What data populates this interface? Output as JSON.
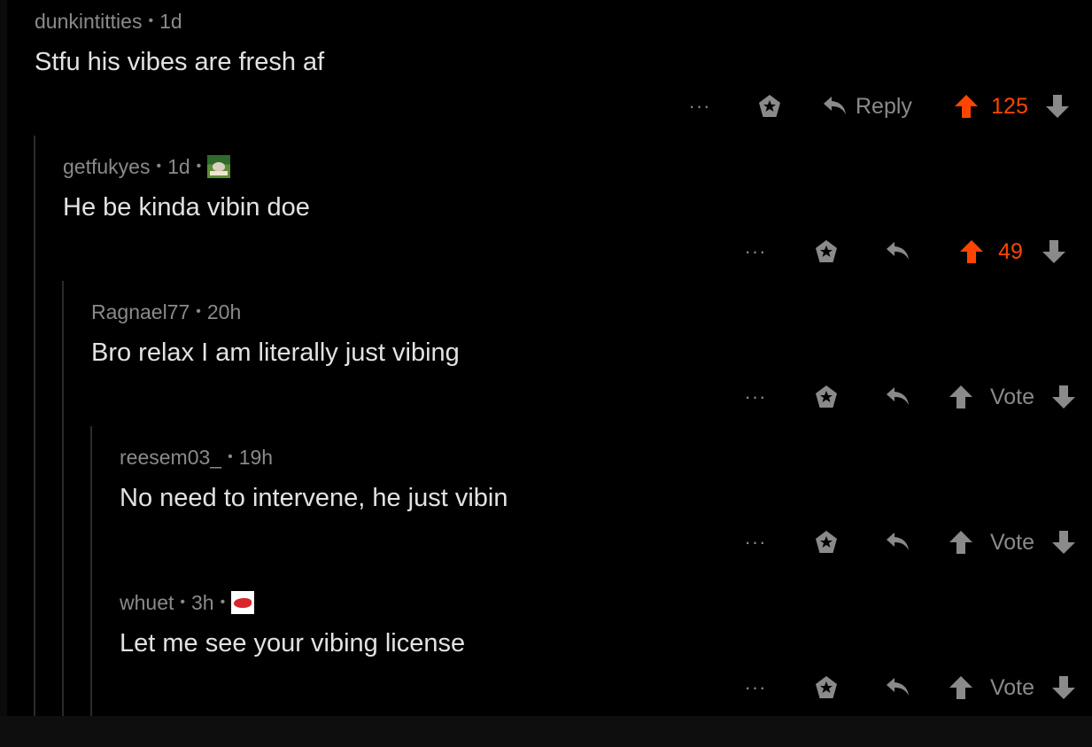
{
  "colors": {
    "background": "#000000",
    "upvoted": "#ff4500",
    "muted": "#8a8a8a",
    "text": "#e2e2e2",
    "thread_line": "#2b2b2b"
  },
  "actions": {
    "more_label": "···",
    "reply_label": "Reply",
    "vote_label": "Vote"
  },
  "comments": [
    {
      "author": "dunkintitties",
      "age": "1d",
      "flair": "",
      "body": "Stfu his vibes are fresh af",
      "score": "125",
      "upvoted": true,
      "depth": 0,
      "reply_text_shown": true
    },
    {
      "author": "getfukyes",
      "age": "1d",
      "flair": "amen-flair-icon",
      "body": "He be kinda vibin doe",
      "score": "49",
      "upvoted": true,
      "depth": 1,
      "reply_text_shown": false
    },
    {
      "author": "Ragnael77",
      "age": "20h",
      "flair": "",
      "body": "Bro relax I am literally just vibing",
      "score": "Vote",
      "upvoted": false,
      "depth": 2,
      "reply_text_shown": false
    },
    {
      "author": "reesem03_",
      "age": "19h",
      "flair": "",
      "body": "No need to intervene, he just vibin",
      "score": "Vote",
      "upvoted": false,
      "depth": 3,
      "reply_text_shown": false
    },
    {
      "author": "whuet",
      "age": "3h",
      "flair": "shoe-flair-icon",
      "body": "Let me see your vibing license",
      "score": "Vote",
      "upvoted": false,
      "depth": 3,
      "reply_text_shown": false
    }
  ]
}
